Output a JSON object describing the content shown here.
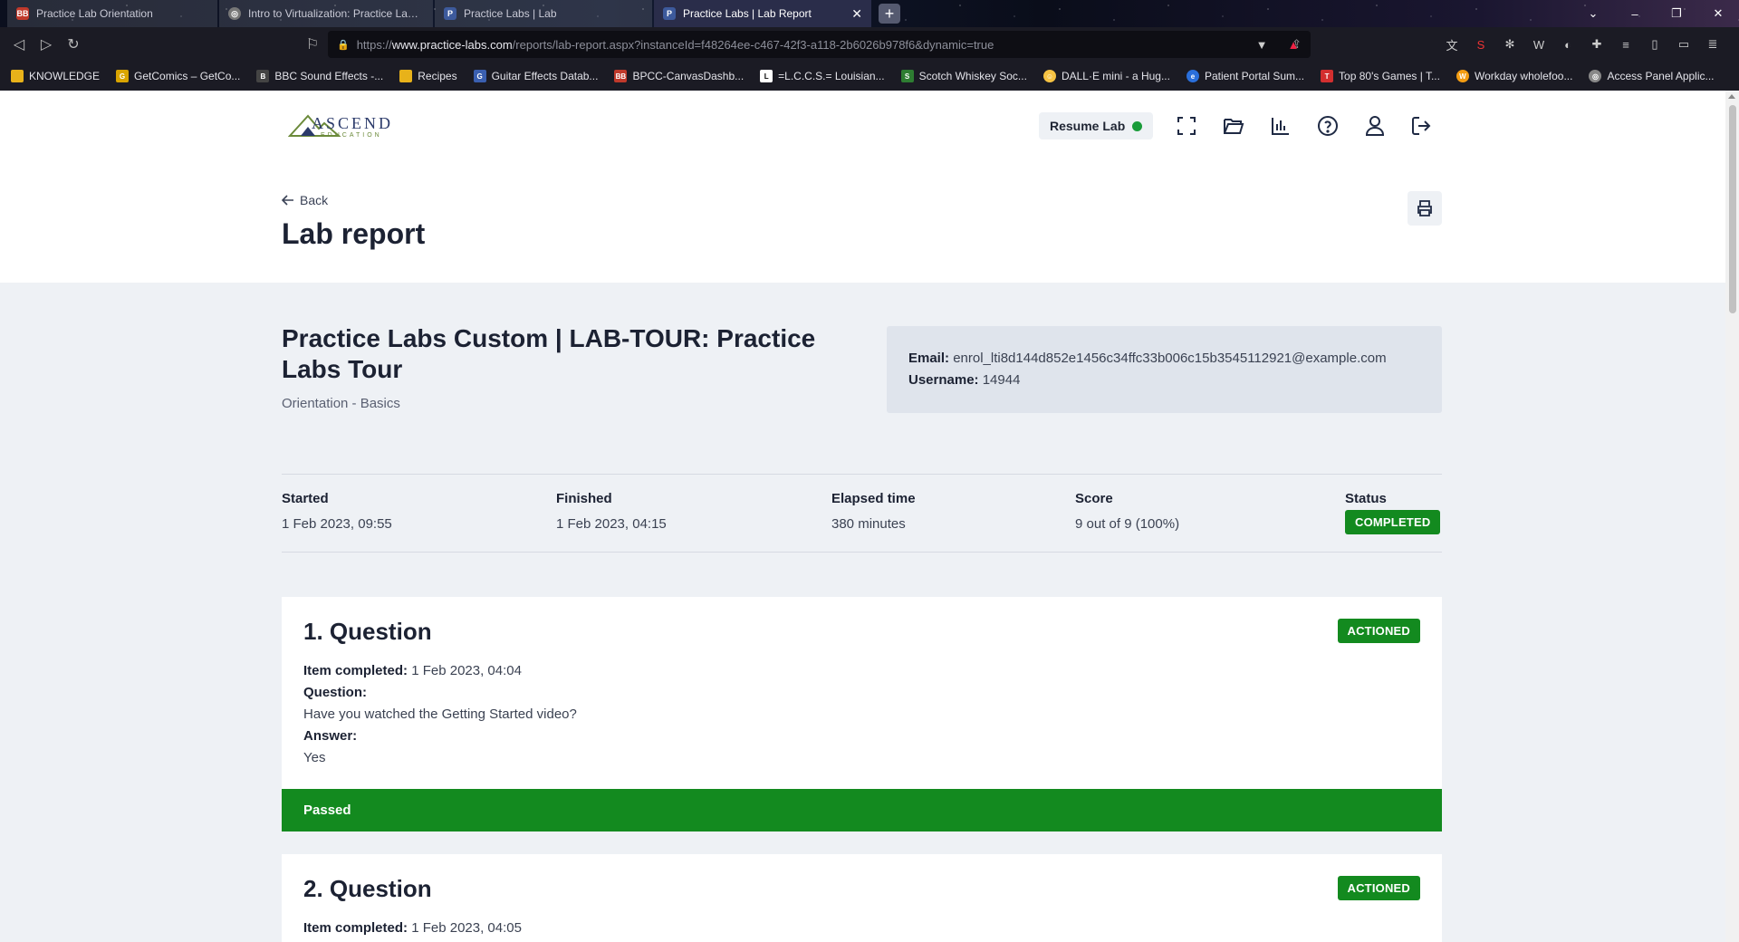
{
  "browser": {
    "tabs": [
      {
        "label": "Practice Lab Orientation",
        "icon": "ascend-favicon",
        "active": false
      },
      {
        "label": "Intro to Virtualization: Practice Lab Or",
        "icon": "globe-favicon",
        "active": false
      },
      {
        "label": "Practice Labs | Lab",
        "icon": "practicelabs-favicon",
        "active": false
      },
      {
        "label": "Practice Labs | Lab Report",
        "icon": "practicelabs-favicon",
        "active": true
      }
    ],
    "url_prefix": "https://",
    "url_host": "www.practice-labs.com",
    "url_path": "/reports/lab-report.aspx?instanceId=f48264ee-c467-42f3-a118-2b6026b978f6&dynamic=true",
    "bookmarks": [
      {
        "label": "KNOWLEDGE",
        "color": "#e8b21a"
      },
      {
        "label": "GetComics – GetCo...",
        "color": "#d9a400"
      },
      {
        "label": "BBC Sound Effects -...",
        "color": "#444444"
      },
      {
        "label": "Recipes",
        "color": "#e8b21a"
      },
      {
        "label": "Guitar Effects Datab...",
        "color": "#3a5fb0"
      },
      {
        "label": "BPCC-CanvasDashb...",
        "color": "#c0392b"
      },
      {
        "label": "=L.C.C.S.= Louisian...",
        "color": "#ffffff"
      },
      {
        "label": "Scotch Whiskey Soc...",
        "color": "#2e7d32"
      },
      {
        "label": "DALL·E mini - a Hug...",
        "color": "#f6c343"
      },
      {
        "label": "Patient Portal Sum...",
        "color": "#2a6fdb"
      },
      {
        "label": "Top 80's Games | T...",
        "color": "#d32f2f"
      },
      {
        "label": "Workday wholefoo...",
        "color": "#f39c12"
      },
      {
        "label": "Access Panel Applic...",
        "color": "#888888"
      }
    ]
  },
  "header": {
    "logo_text": "ASCEND",
    "logo_sub": "EDUCATION",
    "resume_label": "Resume Lab",
    "status_color": "#1a9c3a"
  },
  "page": {
    "back_label": "Back",
    "title": "Lab report"
  },
  "lab": {
    "title": "Practice Labs Custom | LAB-TOUR: Practice Labs Tour",
    "subtitle": "Orientation - Basics",
    "email_label": "Email:",
    "email": "enrol_lti8d144d852e1456c34ffc33b006c15b3545112921@example.com",
    "username_label": "Username:",
    "username": "14944"
  },
  "stats": {
    "started_label": "Started",
    "started": "1 Feb 2023, 09:55",
    "finished_label": "Finished",
    "finished": "1 Feb 2023, 04:15",
    "elapsed_label": "Elapsed time",
    "elapsed": "380 minutes",
    "score_label": "Score",
    "score": "9 out of 9 (100%)",
    "status_label": "Status",
    "status": "COMPLETED"
  },
  "questions": [
    {
      "title": "1. Question",
      "badge": "ACTIONED",
      "completed_label": "Item completed:",
      "completed": "1 Feb 2023, 04:04",
      "question_label": "Question:",
      "question": "Have you watched the Getting Started video?",
      "answer_label": "Answer:",
      "answer": "Yes",
      "result": "Passed"
    },
    {
      "title": "2. Question",
      "badge": "ACTIONED",
      "completed_label": "Item completed:",
      "completed": "1 Feb 2023, 04:05"
    }
  ],
  "colors": {
    "accent_green": "#138a1f",
    "page_bg": "#eef1f5"
  }
}
